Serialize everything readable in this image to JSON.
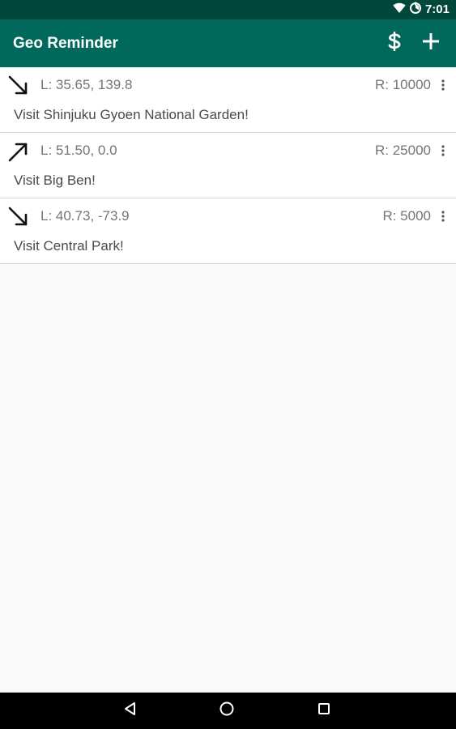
{
  "status_bar": {
    "time": "7:01",
    "icons": [
      "wifi-icon",
      "data-saver-icon"
    ]
  },
  "app_bar": {
    "title": "Geo Reminder",
    "actions": [
      {
        "icon": "dollar-icon"
      },
      {
        "icon": "add-icon"
      }
    ]
  },
  "reminders": [
    {
      "direction_icon": "arrow-down-right-icon",
      "location": "L: 35.65, 139.8",
      "radius": "R: 10000",
      "message": "Visit Shinjuku Gyoen National Garden!"
    },
    {
      "direction_icon": "arrow-up-right-icon",
      "location": "L: 51.50, 0.0",
      "radius": "R: 25000",
      "message": "Visit Big Ben!"
    },
    {
      "direction_icon": "arrow-down-right-icon",
      "location": "L: 40.73, -73.9",
      "radius": "R: 5000",
      "message": "Visit Central Park!"
    }
  ],
  "nav_bar": {
    "buttons": [
      "back-icon",
      "home-icon",
      "recents-icon"
    ]
  },
  "colors": {
    "primary": "#00695c",
    "primary_dark": "#00483b",
    "background": "#fafafa",
    "card": "#ffffff",
    "secondary_text": "#757575",
    "body_text": "#4a4a4a"
  }
}
